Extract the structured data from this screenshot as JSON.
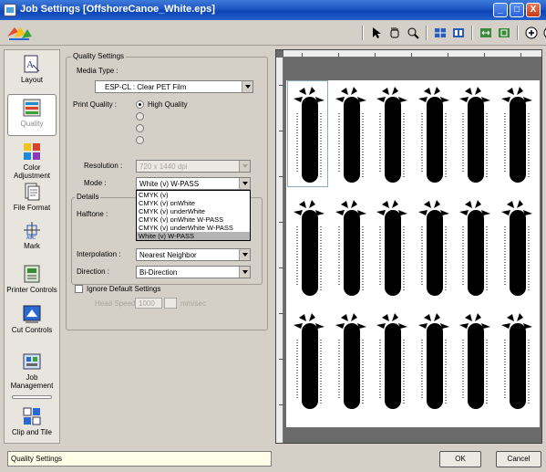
{
  "window": {
    "title": "Job Settings [OffshoreCanoe_White.eps]",
    "minimize": "_",
    "maximize": "□",
    "close": "X"
  },
  "sidebar": {
    "items": [
      {
        "label": "Layout",
        "icon": "layout-icon"
      },
      {
        "label": "Quality",
        "icon": "quality-icon",
        "active": true
      },
      {
        "label": "Color Adjustment",
        "icon": "color-adjustment-icon"
      },
      {
        "label": "File Format",
        "icon": "file-format-icon"
      },
      {
        "label": "Mark",
        "icon": "mark-icon"
      },
      {
        "label": "Printer Controls",
        "icon": "printer-controls-icon"
      },
      {
        "label": "Cut Controls",
        "icon": "cut-controls-icon"
      },
      {
        "label": "Job Management",
        "icon": "job-management-icon"
      },
      {
        "label": "Clip and Tile",
        "icon": "clip-and-tile-icon"
      }
    ]
  },
  "quality": {
    "group_title": "Quality Settings",
    "media_type_label": "Media Type :",
    "media_type_value": "ESP-CL : Clear PET Film",
    "print_quality_label": "Print Quality :",
    "print_quality_option": "High Quality",
    "resolution_label": "Resolution :",
    "resolution_value": "720 x 1440 dpi",
    "mode_label": "Mode :",
    "mode_value": "White (v) W-PASS",
    "mode_options": [
      "CMYK (v)",
      "CMYK (v) onWhite",
      "CMYK (v) underWhite",
      "CMYK (v) onWhite W-PASS",
      "CMYK (v) underWhite W-PASS",
      "White (v) W-PASS"
    ],
    "details_title": "Details",
    "halftone_label": "Halftone :",
    "interpolation_label": "Interpolation :",
    "interpolation_value": "Nearest Neighbor",
    "direction_label": "Direction :",
    "direction_value": "Bi-Direction",
    "ignore_default_label": "Ignore Default Settings",
    "head_speed_label": "Head Speed",
    "head_speed_value": "1000",
    "head_speed_unit": "mm/sec"
  },
  "status_text": "Quality Settings",
  "buttons": {
    "ok": "OK",
    "cancel": "Cancel"
  }
}
